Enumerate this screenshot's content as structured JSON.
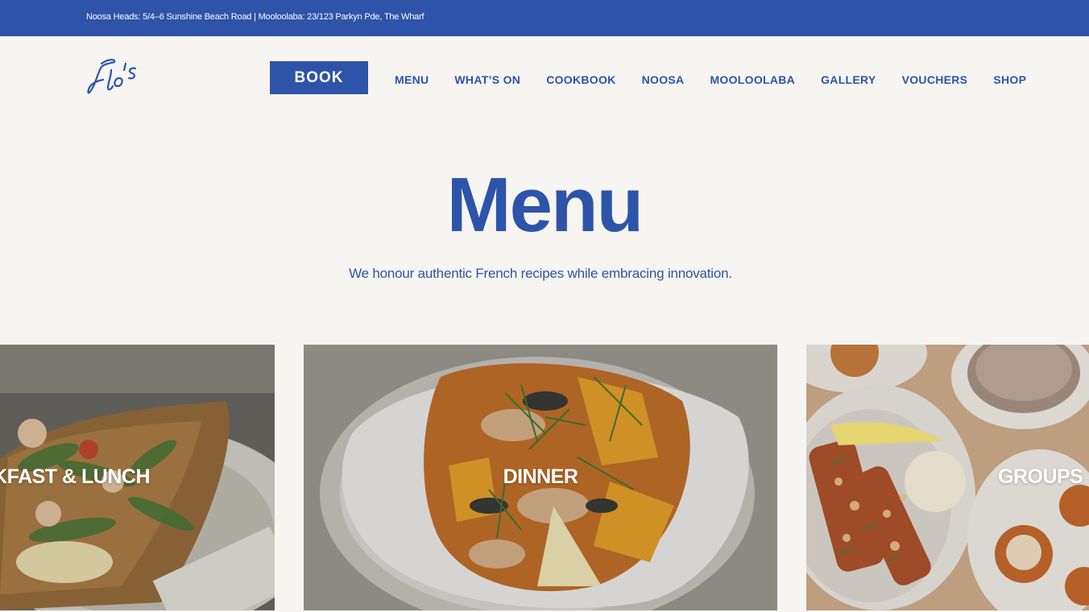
{
  "topbar": {
    "address": "Noosa Heads: 5/4–6 Sunshine Beach Road | Mooloolaba: 23/123 Parkyn Pde, The Wharf"
  },
  "header": {
    "logo_text": "Flo's",
    "book_label": "BOOK",
    "nav": [
      "MENU",
      "WHAT’S ON",
      "COOKBOOK",
      "NOOSA",
      "MOOLOOLABA",
      "GALLERY",
      "VOUCHERS",
      "SHOP"
    ]
  },
  "hero": {
    "title": "Menu",
    "subtitle": "We honour authentic French recipes while embracing innovation."
  },
  "cards": [
    {
      "label": "BREAKFAST & LUNCH"
    },
    {
      "label": "DINNER"
    },
    {
      "label": "GROUPS"
    }
  ],
  "colors": {
    "brand_blue": "#2d54a8",
    "background": "#f6f5f1"
  }
}
